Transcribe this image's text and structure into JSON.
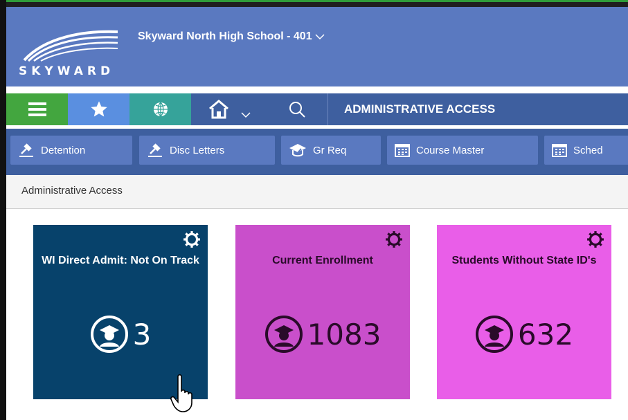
{
  "header": {
    "logo_text": "SKYWARD",
    "school_name": "Skyward North High School - 401",
    "chevron_icon": "chevron-down-icon"
  },
  "nav": {
    "section_label": "ADMINISTRATIVE ACCESS",
    "icons": [
      "menu-icon",
      "star-icon",
      "globe-icon",
      "home-icon",
      "search-icon"
    ]
  },
  "toolbar": {
    "buttons": [
      {
        "label": "Detention",
        "icon": "gavel-icon"
      },
      {
        "label": "Disc Letters",
        "icon": "gavel-icon"
      },
      {
        "label": "Gr Req",
        "icon": "graduation-cap-icon"
      },
      {
        "label": "Course Master",
        "icon": "calendar-icon"
      },
      {
        "label": "Sched",
        "icon": "calendar-icon"
      }
    ]
  },
  "breadcrumb": "Administrative Access",
  "tiles": [
    {
      "title": "WI Direct Admit: Not On Track",
      "count": "3",
      "bg": "#07426b",
      "fg": "#ffffff"
    },
    {
      "title": "Current Enrollment",
      "count": "1083",
      "bg": "#c94fcb",
      "fg": "#2a0b2a"
    },
    {
      "title": "Students Without State ID's",
      "count": "632",
      "bg": "#e95ee8",
      "fg": "#2a0b2a"
    }
  ],
  "colors": {
    "header_bg": "#5a79c0",
    "nav_bg": "#3e5f9f",
    "menu_green": "#43a63f",
    "fav_blue": "#5a8fe0",
    "globe_teal": "#36a39a"
  }
}
